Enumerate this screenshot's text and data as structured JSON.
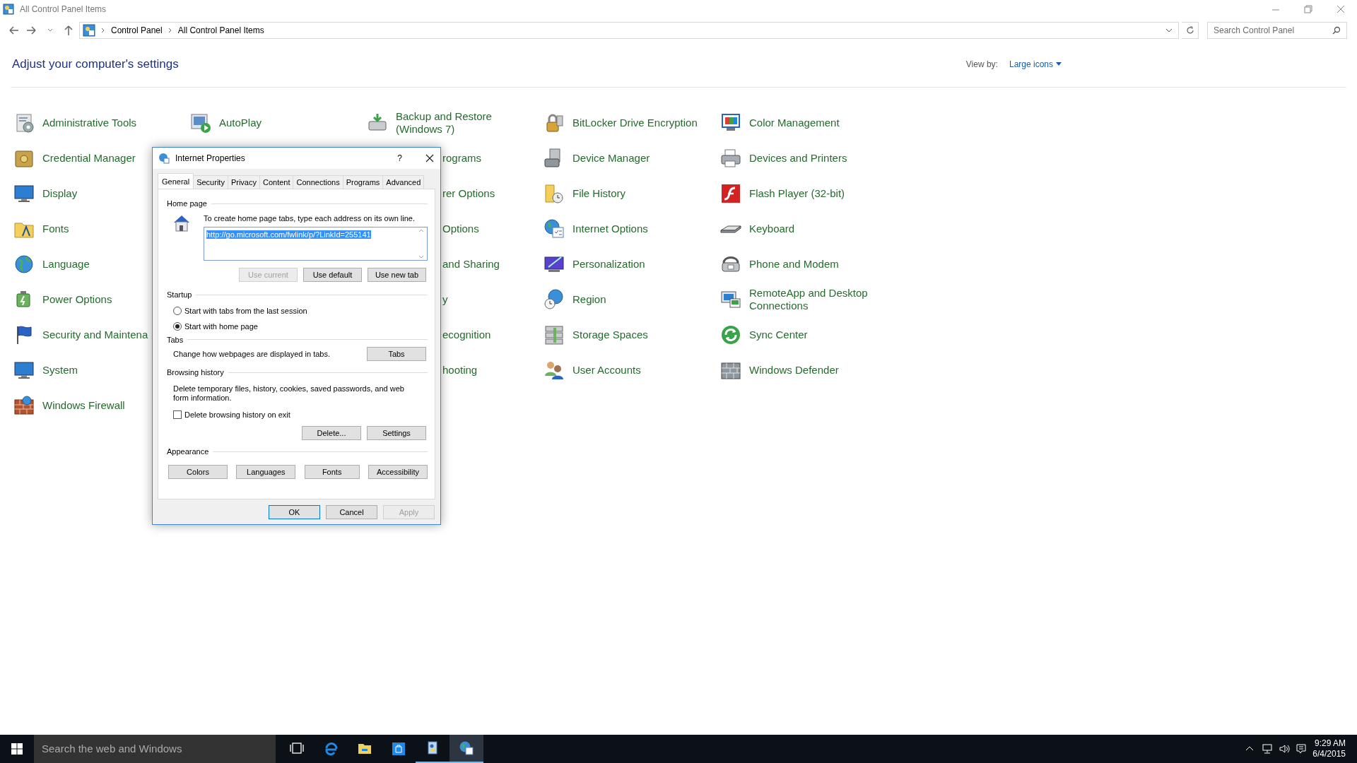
{
  "window": {
    "title": "All Control Panel Items"
  },
  "address_bar": {
    "breadcrumbs": [
      "Control Panel",
      "All Control Panel Items"
    ]
  },
  "search": {
    "placeholder": "Search Control Panel"
  },
  "heading": "Adjust your computer's settings",
  "view_by": {
    "label": "View by:",
    "value": "Large icons"
  },
  "columns": [
    {
      "items": [
        {
          "label": "Administrative Tools",
          "kind": "item"
        },
        {
          "label": "Credential Manager",
          "kind": "item"
        },
        {
          "label": "Display",
          "kind": "item"
        },
        {
          "label": "Fonts",
          "kind": "item"
        },
        {
          "label": "Language",
          "kind": "item"
        },
        {
          "label": "Power Options",
          "kind": "item"
        },
        {
          "label": "Security and Maintena",
          "kind": "item"
        },
        {
          "label": "System",
          "kind": "item"
        },
        {
          "label": "Windows Firewall",
          "kind": "item"
        }
      ]
    },
    {
      "items": [
        {
          "label": "AutoPlay",
          "kind": "item"
        }
      ]
    },
    {
      "items": [
        {
          "label": "Backup and Restore (Windows 7)",
          "kind": "item"
        },
        {
          "label": "rograms",
          "kind": "partial"
        },
        {
          "label": "rer Options",
          "kind": "partial"
        },
        {
          "label": "Options",
          "kind": "partial"
        },
        {
          "label": "and Sharing",
          "kind": "partial"
        },
        {
          "label": "y",
          "kind": "partial"
        },
        {
          "label": "ecognition",
          "kind": "partial"
        },
        {
          "label": "hooting",
          "kind": "partial"
        }
      ]
    },
    {
      "items": [
        {
          "label": "BitLocker Drive Encryption",
          "kind": "item"
        },
        {
          "label": "Device Manager",
          "kind": "item"
        },
        {
          "label": "File History",
          "kind": "item"
        },
        {
          "label": "Internet Options",
          "kind": "item"
        },
        {
          "label": "Personalization",
          "kind": "item"
        },
        {
          "label": "Region",
          "kind": "item"
        },
        {
          "label": "Storage Spaces",
          "kind": "item"
        },
        {
          "label": "User Accounts",
          "kind": "item"
        }
      ]
    },
    {
      "items": [
        {
          "label": "Color Management",
          "kind": "item"
        },
        {
          "label": "Devices and Printers",
          "kind": "item"
        },
        {
          "label": "Flash Player (32-bit)",
          "kind": "item"
        },
        {
          "label": "Keyboard",
          "kind": "item"
        },
        {
          "label": "Phone and Modem",
          "kind": "item"
        },
        {
          "label": "RemoteApp and Desktop Connections",
          "kind": "item"
        },
        {
          "label": "Sync Center",
          "kind": "item"
        },
        {
          "label": "Windows Defender",
          "kind": "item"
        }
      ]
    }
  ],
  "dialog": {
    "title": "Internet Properties",
    "help": "?",
    "tabs": [
      {
        "label": "General",
        "selected": true
      },
      {
        "label": "Security",
        "selected": false
      },
      {
        "label": "Privacy",
        "selected": false
      },
      {
        "label": "Content",
        "selected": false
      },
      {
        "label": "Connections",
        "selected": false
      },
      {
        "label": "Programs",
        "selected": false
      },
      {
        "label": "Advanced",
        "selected": false
      }
    ],
    "home_page": {
      "heading": "Home page",
      "instruction": "To create home page tabs, type each address on its own line.",
      "address": {
        "value": "http://go.microsoft.com/fwlink/p/?LinkId=255141",
        "selected": true
      },
      "buttons": [
        {
          "label": "Use current",
          "disabled": true
        },
        {
          "label": "Use default",
          "disabled": false
        },
        {
          "label": "Use new tab",
          "disabled": false
        }
      ]
    },
    "startup": {
      "heading": "Startup",
      "options": [
        {
          "label": "Start with tabs from the last session",
          "selected": false
        },
        {
          "label": "Start with home page",
          "selected": true
        }
      ]
    },
    "tabs_section": {
      "heading": "Tabs",
      "text": "Change how webpages are displayed in tabs.",
      "button": "Tabs"
    },
    "browsing_history": {
      "heading": "Browsing history",
      "text": "Delete temporary files, history, cookies, saved passwords, and web form information.",
      "checkbox": {
        "label": "Delete browsing history on exit",
        "checked": false
      },
      "buttons": [
        "Delete...",
        "Settings"
      ]
    },
    "appearance": {
      "heading": "Appearance",
      "buttons": [
        "Colors",
        "Languages",
        "Fonts",
        "Accessibility"
      ]
    },
    "footer_buttons": [
      {
        "label": "OK",
        "default": true,
        "disabled": false
      },
      {
        "label": "Cancel",
        "default": false,
        "disabled": false
      },
      {
        "label": "Apply",
        "default": false,
        "disabled": true
      }
    ]
  },
  "taskbar": {
    "search_placeholder": "Search the web and Windows",
    "apps": [
      {
        "running": false,
        "active": false
      },
      {
        "running": false,
        "active": false
      },
      {
        "running": false,
        "active": false
      },
      {
        "running": false,
        "active": false
      },
      {
        "running": true,
        "active": false
      },
      {
        "running": true,
        "active": true
      }
    ],
    "time": "9:29 AM",
    "date": "6/4/2015"
  }
}
